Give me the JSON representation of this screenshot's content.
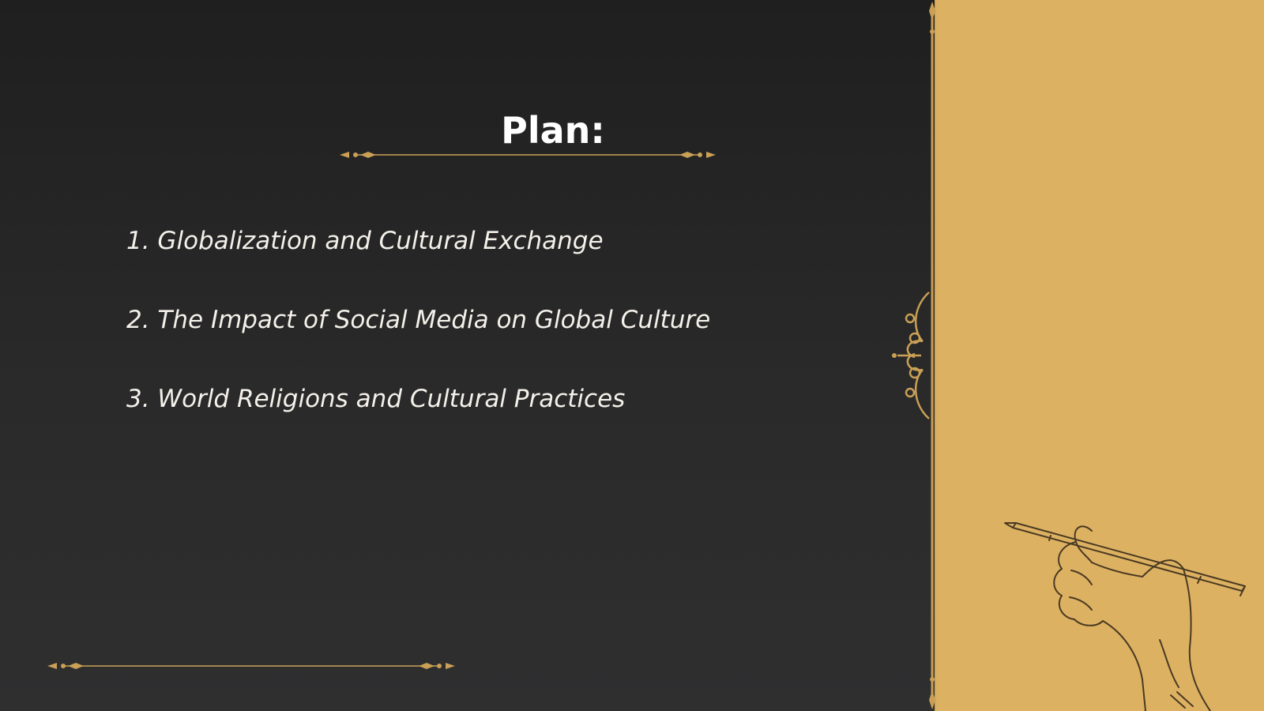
{
  "slide": {
    "title": "Plan:",
    "items": [
      "1. Globalization and Cultural Exchange",
      "2. The Impact of Social Media on Global Culture",
      "3. World Religions and Cultural Practices"
    ]
  },
  "colors": {
    "background": "#262626",
    "panel": "#ddb162",
    "accent_gold": "#c9a055",
    "text": "#ffffff"
  },
  "decorations": {
    "divider": "ornamental-gold-divider",
    "flourish": "scroll-flourish-ornament",
    "illustration": "hand-holding-pencil-sketch"
  }
}
